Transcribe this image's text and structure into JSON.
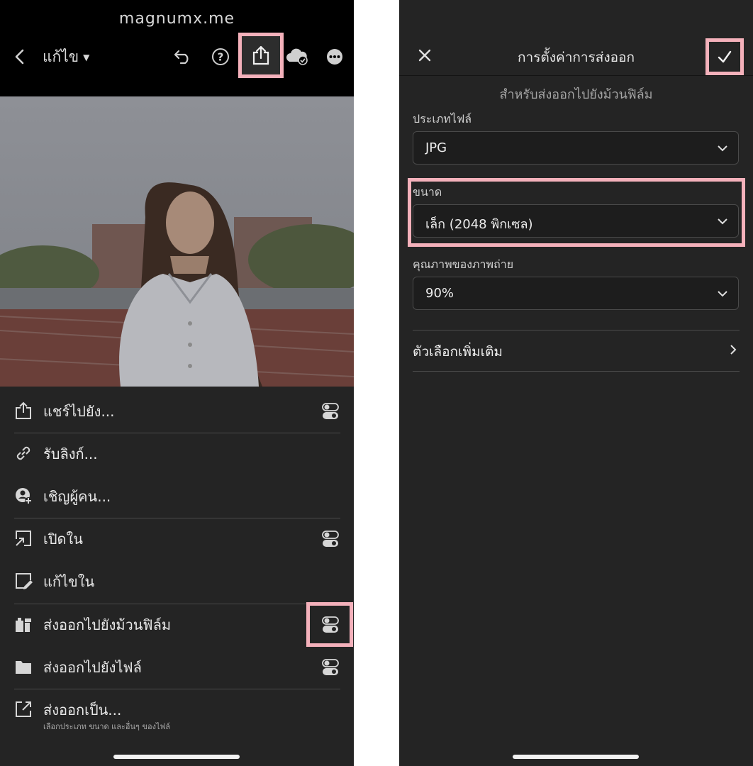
{
  "left": {
    "watermark": "magnumx.me",
    "toolbar": {
      "edit_label": "แก้ไข",
      "icons": [
        "back-icon",
        "undo-icon",
        "help-icon",
        "share-export-icon",
        "cloud-sync-icon",
        "more-icon"
      ]
    },
    "menu": [
      {
        "label": "แชร์ไปยัง...",
        "icon": "share-icon",
        "toggle": true
      },
      {
        "label": "รับลิงก์...",
        "icon": "link-icon",
        "toggle": false
      },
      {
        "label": "เชิญผู้คน...",
        "icon": "invite-people-icon",
        "toggle": false
      },
      {
        "label": "เปิดใน",
        "icon": "open-in-icon",
        "toggle": true
      },
      {
        "label": "แก้ไขใน",
        "icon": "edit-in-icon",
        "toggle": false
      },
      {
        "label": "ส่งออกไปยังม้วนฟิล์ม",
        "icon": "camera-roll-icon",
        "toggle": true
      },
      {
        "label": "ส่งออกไปยังไฟล์",
        "icon": "folder-icon",
        "toggle": true
      },
      {
        "label": "ส่งออกเป็น...",
        "sub": "เลือกประเภท ขนาด และอื่นๆ ของไฟล์",
        "icon": "export-as-icon",
        "toggle": false
      }
    ]
  },
  "right": {
    "title": "การตั้งค่าการส่งออก",
    "subtitle": "สำหรับส่งออกไปยังม้วนฟิล์ม",
    "fields": [
      {
        "label": "ประเภทไฟล์",
        "value": "JPG"
      },
      {
        "label": "ขนาด",
        "value": "เล็ก (2048 พิกเซล)"
      },
      {
        "label": "คุณภาพของภาพถ่าย",
        "value": "90%"
      }
    ],
    "more_options": "ตัวเลือกเพิ่มเติม"
  },
  "colors": {
    "highlight": "#f4b1bb",
    "panel_bg": "#242424",
    "toolbar_bg": "#000000"
  }
}
